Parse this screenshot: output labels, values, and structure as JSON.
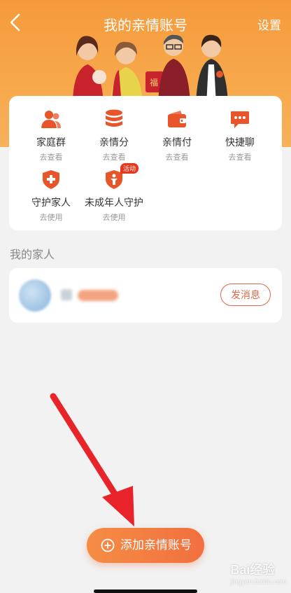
{
  "header": {
    "title": "我的亲情账号",
    "settings": "设置"
  },
  "features": [
    {
      "label": "家庭群",
      "sub": "去查看",
      "icon": "family-group-icon"
    },
    {
      "label": "亲情分",
      "sub": "去查看",
      "icon": "points-stack-icon"
    },
    {
      "label": "亲情付",
      "sub": "去查看",
      "icon": "wallet-icon"
    },
    {
      "label": "快捷聊",
      "sub": "去查看",
      "icon": "chat-bubble-icon"
    },
    {
      "label": "守护家人",
      "sub": "去使用",
      "icon": "shield-plus-icon"
    },
    {
      "label": "未成年人守护",
      "sub": "去使用",
      "icon": "child-shield-icon",
      "badge": "活动"
    }
  ],
  "family": {
    "section_title": "我的家人",
    "send_label": "发消息"
  },
  "add_button": {
    "label": "添加亲情账号"
  },
  "watermark": {
    "brand": "Bai经验",
    "url": "jingyan.baidu.com"
  },
  "colors": {
    "accent": "#f26f3f",
    "header": "#f59a3c"
  }
}
